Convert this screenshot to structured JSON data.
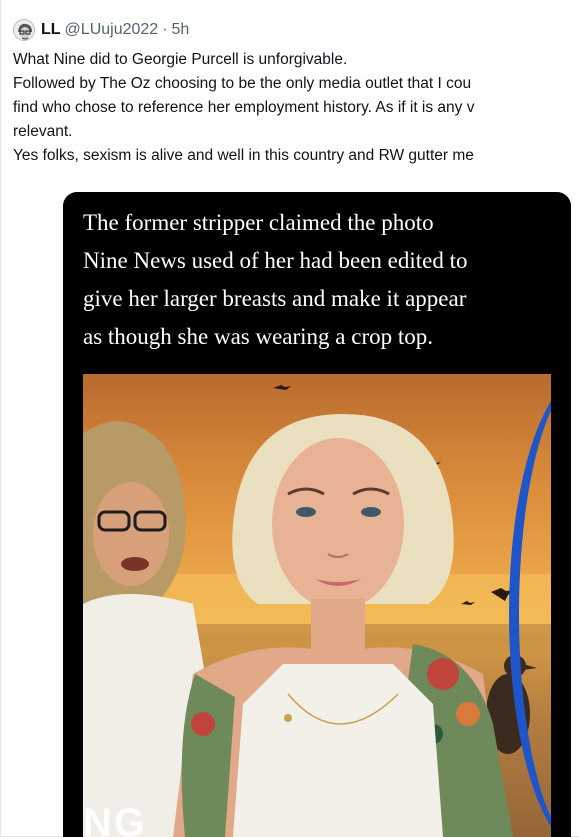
{
  "tweet": {
    "author_name": "LL",
    "handle": "@LUuju2022",
    "separator": "·",
    "time": "5h",
    "lines": [
      "What Nine did to Georgie Purcell is unforgivable.",
      "Followed by The Oz choosing to be the only media outlet that I cou",
      "find who chose to reference her employment history. As if it is any v",
      "relevant.",
      "Yes folks, sexism is alive and well in this country and RW gutter me"
    ]
  },
  "media": {
    "caption_lines": [
      "The former stripper claimed the photo",
      "Nine News used of her had been edited to",
      "give her larger breasts and make it appear",
      "as though she was wearing a crop top."
    ],
    "banner_text": "NG"
  },
  "colors": {
    "text": "#0f1419",
    "secondary": "#536471",
    "ring_blue": "#1e55c8"
  }
}
